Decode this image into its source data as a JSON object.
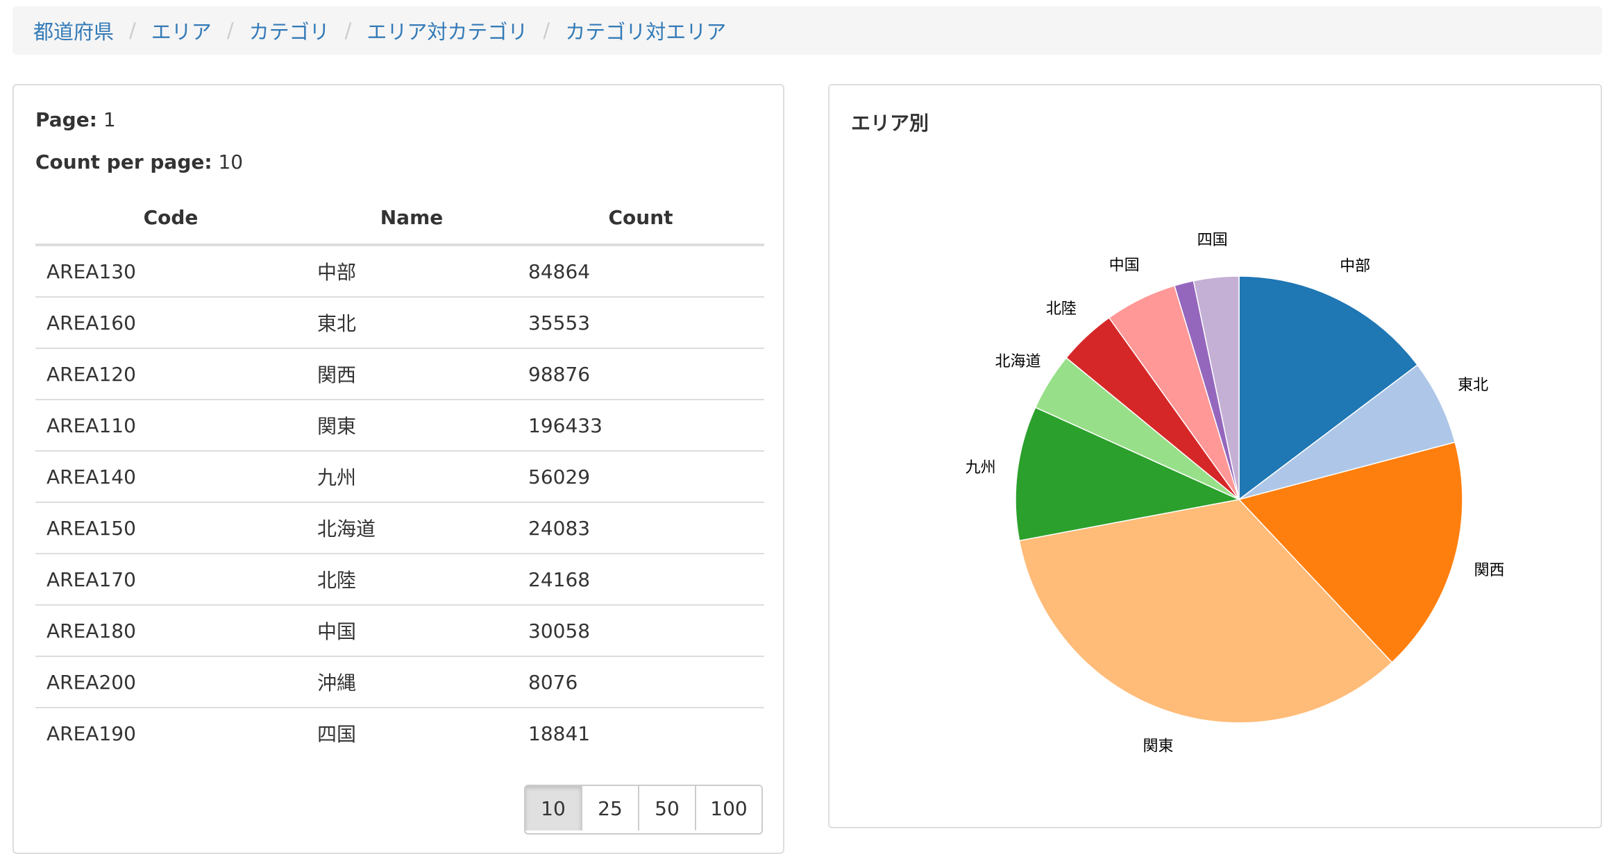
{
  "breadcrumb": {
    "items": [
      {
        "label": "都道府県"
      },
      {
        "label": "エリア"
      },
      {
        "label": "カテゴリ"
      },
      {
        "label": "エリア対カテゴリ"
      },
      {
        "label": "カテゴリ対エリア"
      }
    ],
    "separator": "/"
  },
  "table_panel": {
    "page_label": "Page:",
    "page_value": "1",
    "count_label": "Count per page:",
    "count_value": "10",
    "headers": [
      "Code",
      "Name",
      "Count"
    ],
    "rows": [
      {
        "code": "AREA130",
        "name": "中部",
        "count": "84864"
      },
      {
        "code": "AREA160",
        "name": "東北",
        "count": "35553"
      },
      {
        "code": "AREA120",
        "name": "関西",
        "count": "98876"
      },
      {
        "code": "AREA110",
        "name": "関東",
        "count": "196433"
      },
      {
        "code": "AREA140",
        "name": "九州",
        "count": "56029"
      },
      {
        "code": "AREA150",
        "name": "北海道",
        "count": "24083"
      },
      {
        "code": "AREA170",
        "name": "北陸",
        "count": "24168"
      },
      {
        "code": "AREA180",
        "name": "中国",
        "count": "30058"
      },
      {
        "code": "AREA200",
        "name": "沖縄",
        "count": "8076"
      },
      {
        "code": "AREA190",
        "name": "四国",
        "count": "18841"
      }
    ],
    "page_sizes": [
      "10",
      "25",
      "50",
      "100"
    ],
    "selected_page_size": "10"
  },
  "chart_panel": {
    "title": "エリア別"
  },
  "chart_data": {
    "type": "pie",
    "title": "エリア別",
    "categories": [
      "中部",
      "東北",
      "関西",
      "関東",
      "九州",
      "北海道",
      "北陸",
      "中国",
      "沖縄",
      "四国"
    ],
    "values": [
      84864,
      35553,
      98876,
      196433,
      56029,
      24083,
      24168,
      30058,
      8076,
      18841
    ],
    "colors": [
      "#1f77b4",
      "#aec7e8",
      "#ff7f0e",
      "#ffbb78",
      "#2ca02c",
      "#98df8a",
      "#d62728",
      "#ff9896",
      "#9467bd",
      "#c5b0d5"
    ],
    "labels_shown": [
      "中部",
      "東北",
      "関西",
      "関東",
      "九州",
      "北海道",
      "北陸",
      "中国",
      "四国"
    ],
    "legend": "none"
  },
  "colors": {
    "link": "#337ab7",
    "border": "#dddddd",
    "breadcrumb_bg": "#f5f5f5"
  }
}
